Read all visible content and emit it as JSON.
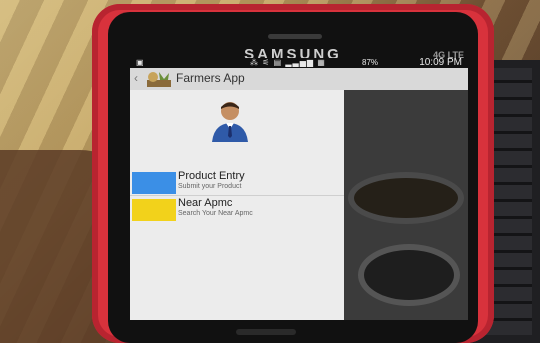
{
  "device": {
    "brand": "SAMSUNG",
    "network_badge": "4G LTE"
  },
  "status_bar": {
    "left": "▣",
    "icons": "⁂ ⚟ ▤ ▂▃▅▆ ▦",
    "battery": "87%",
    "time": "10:09 PM"
  },
  "action_bar": {
    "back_glyph": "‹",
    "title": "Farmers App"
  },
  "drawer": {
    "items": [
      {
        "title": "Product Entry",
        "subtitle": "Submit your Product",
        "color": "#3b8fe6"
      },
      {
        "title": "Near Apmc",
        "subtitle": "Search Your Near Apmc",
        "color": "#f2d21b"
      }
    ]
  },
  "colors": {
    "case": "#d8323c",
    "action_bar": "#d9d9d9",
    "drawer": "#ececec"
  }
}
